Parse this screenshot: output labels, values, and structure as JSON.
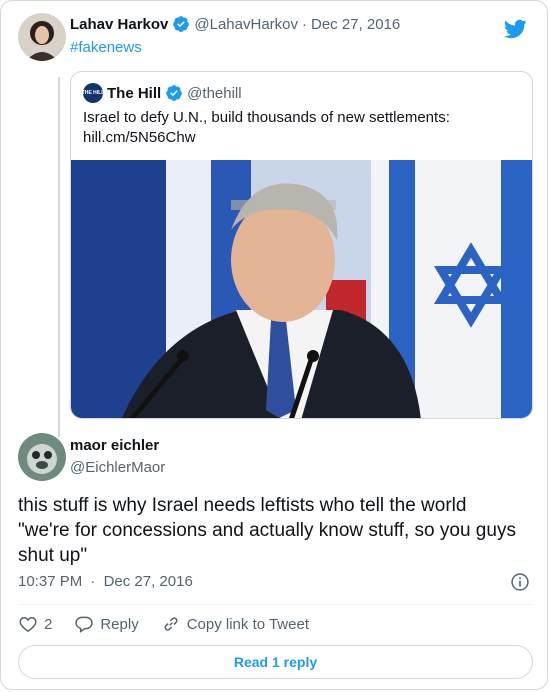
{
  "parent_tweet": {
    "display_name": "Lahav Harkov",
    "handle": "@LahavHarkov",
    "separator": "·",
    "date": "Dec 27, 2016",
    "hashtag": "#fakenews"
  },
  "quoted_tweet": {
    "display_name": "The Hill",
    "handle": "@thehill",
    "avatar_text": "THE HILL",
    "text": "Israel to defy U.N., build thousands of new settlements: hill.cm/5N56Chw"
  },
  "main_tweet": {
    "display_name": "maor eichler",
    "handle": "@EichlerMaor",
    "text": "this stuff is why Israel needs leftists who tell the world \"we're for concessions and actually know stuff, so you guys shut up\"",
    "time": "10:37 PM",
    "separator": "·",
    "date": "Dec 27, 2016"
  },
  "actions": {
    "like_count": "2",
    "reply_label": "Reply",
    "copy_link_label": "Copy link to Tweet",
    "read_replies_label": "Read 1 reply"
  },
  "colors": {
    "accent": "#1d9bf0",
    "text_primary": "#0f1419",
    "text_secondary": "#536471",
    "border": "#cfd9de"
  },
  "icons": [
    "verified-badge-icon",
    "twitter-bird-icon",
    "info-icon",
    "heart-icon",
    "reply-bubble-icon",
    "link-icon"
  ]
}
